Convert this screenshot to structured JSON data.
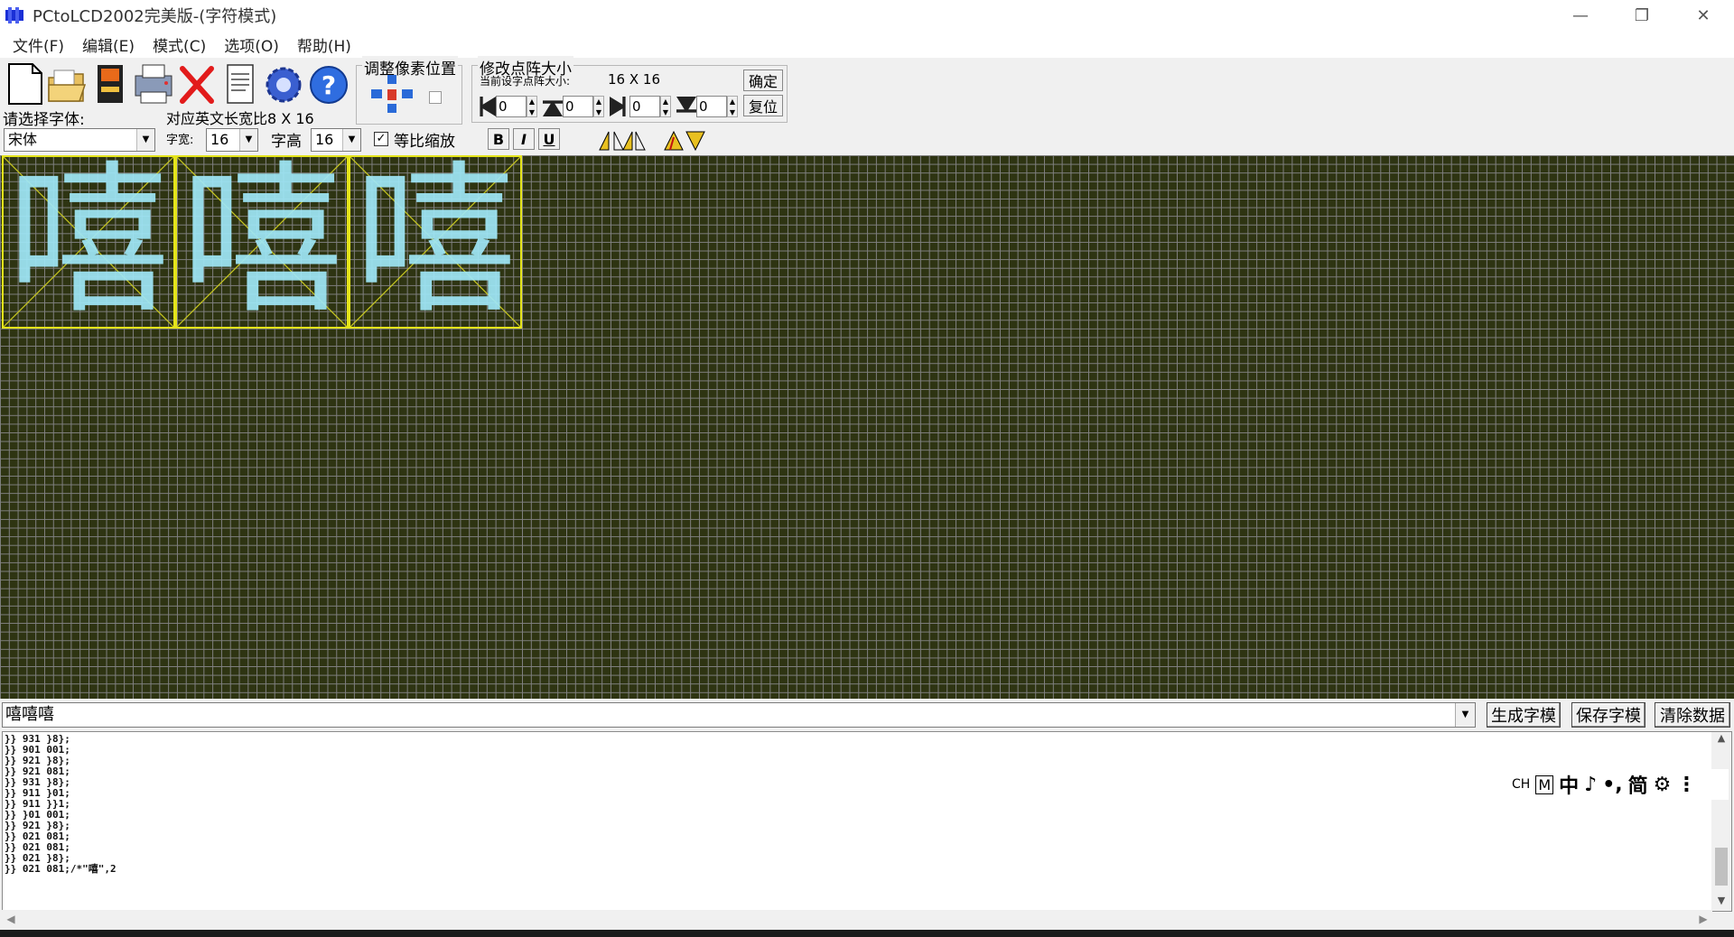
{
  "window": {
    "title": "PCtoLCD2002完美版-(字符模式)",
    "controls": [
      "—",
      "❐",
      "✕"
    ]
  },
  "menu": [
    {
      "label": "文件(F)"
    },
    {
      "label": "编辑(E)"
    },
    {
      "label": "模式(C)"
    },
    {
      "label": "选项(O)"
    },
    {
      "label": "帮助(H)"
    }
  ],
  "toolbar": {
    "icons": [
      "new-file-icon",
      "open-folder-icon",
      "save-disk-icon",
      "print-icon",
      "delete-x-icon",
      "notepad-icon",
      "settings-gear-icon",
      "help-icon"
    ],
    "select_font_label": "请选择字体:",
    "font_value": "宋体",
    "ratio_label": "对应英文长宽比8 X 16",
    "width_label": "字宽:",
    "width_value": "16",
    "height_label": "字高",
    "height_value": "16",
    "proportional_label": "等比缩放",
    "proportional_checked": "✓",
    "bold_label": "B",
    "italic_label": "I",
    "underline_label": "U",
    "pixel_group_title": "调整像素位置",
    "matrix_group_title": "修改点阵大小",
    "current_size_label": "当前设字点阵大小:",
    "current_size_value": "16 X 16",
    "confirm_label": "确定",
    "reset_label": "复位",
    "spin_values": [
      "0",
      "0",
      "0",
      "0"
    ]
  },
  "canvas": {
    "glyphs": [
      "嘻",
      "嘻",
      "嘻"
    ],
    "accent_color": "#e4e41a",
    "pixel_color": "#9fe7f7",
    "background_color": "#2e3412"
  },
  "input": {
    "text": "嘻嘻嘻",
    "buttons": [
      "生成字模",
      "保存字模",
      "清除数据"
    ]
  },
  "output": {
    "lines": [
      "}} 931 }8};",
      "}} 901 001;",
      "}} 921 }8};",
      "}} 921 081;",
      "}} 931 }8};",
      "}} 911 }01;",
      "}} 911 }}1;",
      "}} }01 001;",
      "}} 921 }8};",
      "}} 021 081;",
      "}} 021 081;",
      "}} 021 }8};",
      "}} 021 081;/*\"嘻\",2"
    ]
  },
  "ime": {
    "ch": "CH",
    "m": "M",
    "items": [
      "中",
      "♪",
      "•,",
      "简",
      "⚙",
      "⋮"
    ]
  }
}
